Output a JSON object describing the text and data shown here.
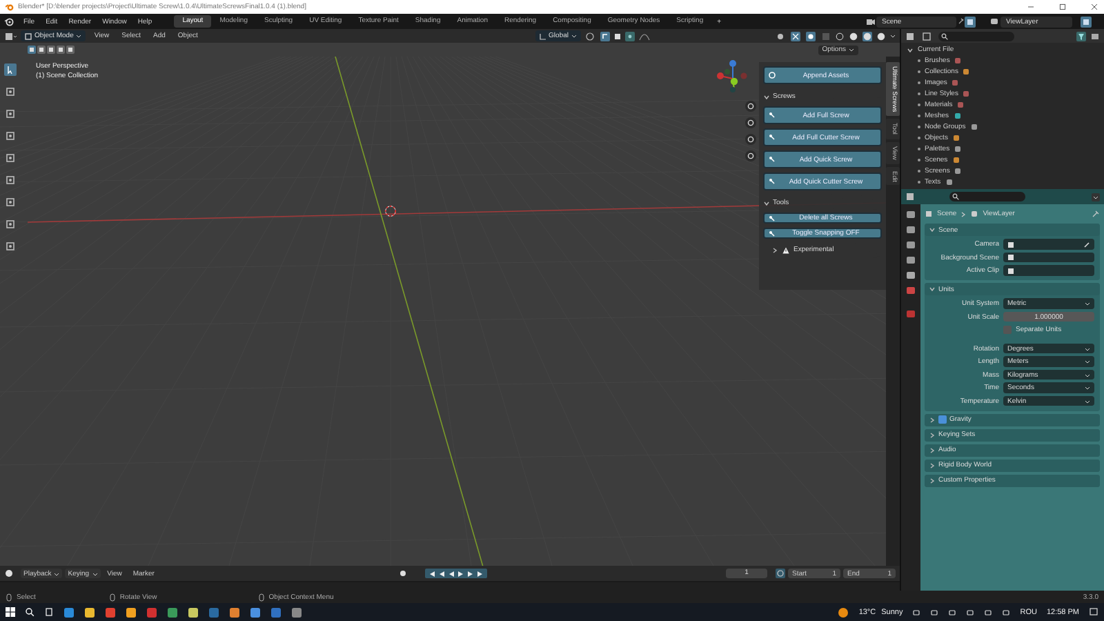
{
  "window": {
    "title": "Blender* [D:\\blender projects\\Project\\Ultimate Screw\\1.0.4\\UltimateScrewsFinal1.0.4 (1).blend]"
  },
  "menu": [
    "File",
    "Edit",
    "Render",
    "Window",
    "Help"
  ],
  "workspaces": [
    {
      "label": "Layout",
      "selected": true
    },
    {
      "label": "Modeling",
      "selected": false
    },
    {
      "label": "Sculpting",
      "selected": false
    },
    {
      "label": "UV Editing",
      "selected": false
    },
    {
      "label": "Texture Paint",
      "selected": false
    },
    {
      "label": "Shading",
      "selected": false
    },
    {
      "label": "Animation",
      "selected": false
    },
    {
      "label": "Rendering",
      "selected": false
    },
    {
      "label": "Compositing",
      "selected": false
    },
    {
      "label": "Geometry Nodes",
      "selected": false
    },
    {
      "label": "Scripting",
      "selected": false
    }
  ],
  "add_workspace": "+",
  "scene": "Scene",
  "view_layer": "ViewLayer",
  "viewport": {
    "mode": "Object Mode",
    "menus": [
      "View",
      "Select",
      "Add",
      "Object"
    ],
    "orientation": "Global",
    "options": "Options",
    "shading": [
      {
        "selected": false
      },
      {
        "selected": false
      },
      {
        "selected": true
      },
      {
        "selected": false
      }
    ],
    "overlay_lines": [
      "User Perspective",
      "(1) Scene Collection"
    ]
  },
  "sidebar": {
    "tabs": [
      {
        "label": "Ultimate Screws",
        "selected": true
      },
      {
        "label": "Tool",
        "selected": false
      },
      {
        "label": "View",
        "selected": false
      },
      {
        "label": "Edit",
        "selected": false
      }
    ],
    "append": "Append Assets",
    "sections": [
      {
        "title": "Screws",
        "expanded": true,
        "kind": "large",
        "buttons": [
          "Add Full Screw",
          "Add Full Cutter Screw",
          "Add Quick Screw",
          "Add Quick Cutter Screw"
        ]
      },
      {
        "title": "Tools",
        "expanded": true,
        "kind": "small",
        "buttons": [
          "Delete all Screws",
          "Toggle Snapping OFF"
        ]
      }
    ],
    "experimental": {
      "label": "Experimental",
      "expanded": false
    }
  },
  "outliner": {
    "root": "Current File",
    "expanded": true,
    "items": [
      "Brushes",
      "Collections",
      "Images",
      "Line Styles",
      "Materials",
      "Meshes",
      "Node Groups",
      "Objects",
      "Palettes",
      "Scenes",
      "Screens",
      "Texts"
    ]
  },
  "properties": {
    "breadcrumb": [
      "Scene",
      "ViewLayer"
    ],
    "panels": [
      {
        "title": "Scene",
        "expanded": true,
        "rows": [
          {
            "kind": "object",
            "label": "Camera"
          },
          {
            "kind": "object",
            "label": "Background Scene"
          },
          {
            "kind": "object",
            "label": "Active Clip"
          }
        ]
      },
      {
        "title": "Units",
        "expanded": true,
        "rows": [
          {
            "kind": "dropdown",
            "label": "Unit System",
            "value": "Metric"
          },
          {
            "kind": "number",
            "label": "Unit Scale",
            "value": "1.000000"
          },
          {
            "kind": "checkbox",
            "label": "Separate Units",
            "checked": false
          },
          {
            "kind": "dropdown",
            "label": "Rotation",
            "value": "Degrees"
          },
          {
            "kind": "dropdown",
            "label": "Length",
            "value": "Meters"
          },
          {
            "kind": "dropdown",
            "label": "Mass",
            "value": "Kilograms"
          },
          {
            "kind": "dropdown",
            "label": "Time",
            "value": "Seconds"
          },
          {
            "kind": "dropdown",
            "label": "Temperature",
            "value": "Kelvin"
          }
        ]
      },
      {
        "title": "Gravity",
        "expanded": false,
        "checked": true
      },
      {
        "title": "Keying Sets",
        "expanded": false
      },
      {
        "title": "Audio",
        "expanded": false
      },
      {
        "title": "Rigid Body World",
        "expanded": false
      },
      {
        "title": "Custom Properties",
        "expanded": false
      }
    ]
  },
  "timeline": {
    "menus": [
      "Playback",
      "Keying",
      "View",
      "Marker"
    ],
    "current_frame": "1",
    "start_label": "Start",
    "start": "1",
    "end_label": "End",
    "end": "1"
  },
  "status_bar": {
    "hints": [
      "Select",
      "Rotate View",
      "Object Context Menu"
    ],
    "version": "3.3.0"
  },
  "taskbar": {
    "temperature": "13°C",
    "weather": "Sunny",
    "language": "ROU",
    "time": "12:58 PM"
  }
}
